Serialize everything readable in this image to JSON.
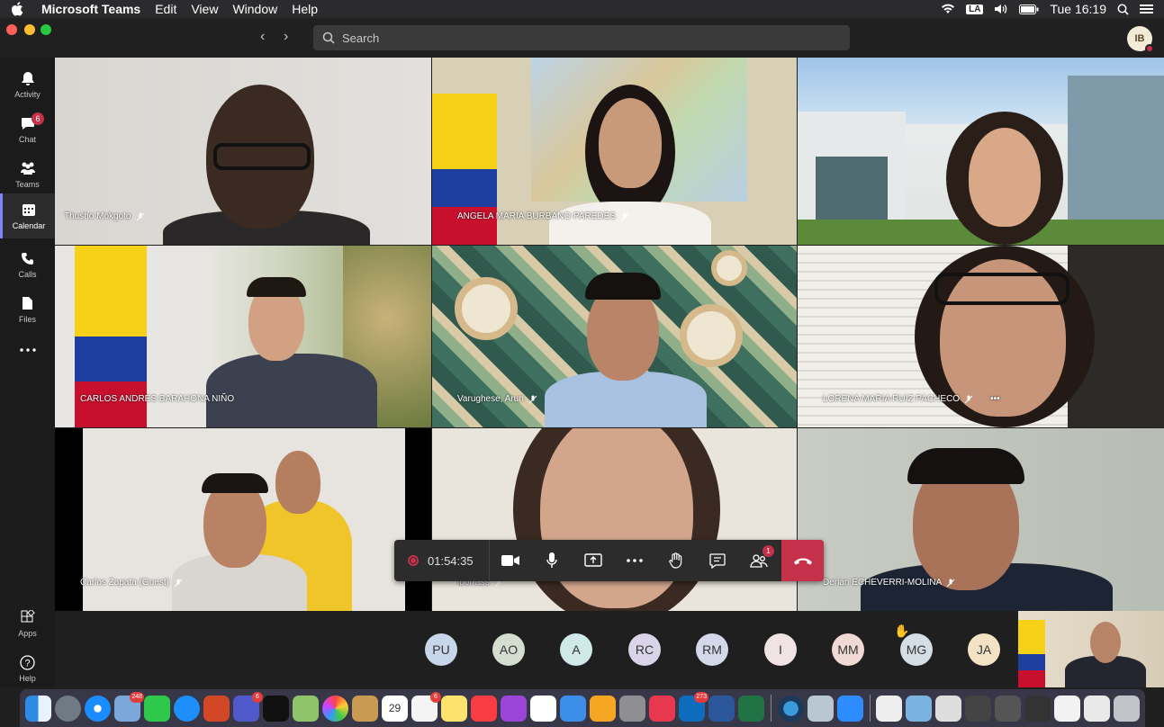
{
  "menubar": {
    "app_name": "Microsoft Teams",
    "items": [
      "Edit",
      "View",
      "Window",
      "Help"
    ],
    "input_source": "LA",
    "clock": "Tue 16:19"
  },
  "titlebar": {
    "search_placeholder": "Search",
    "profile_initials": "IB"
  },
  "rail": [
    {
      "label": "Activity",
      "icon": "bell-icon"
    },
    {
      "label": "Chat",
      "icon": "chat-icon",
      "badge": "6"
    },
    {
      "label": "Teams",
      "icon": "teams-icon"
    },
    {
      "label": "Calendar",
      "icon": "calendar-icon",
      "active": true
    },
    {
      "label": "Calls",
      "icon": "phone-icon"
    },
    {
      "label": "Files",
      "icon": "file-icon"
    },
    {
      "label": "Apps",
      "icon": "apps-icon"
    },
    {
      "label": "Help",
      "icon": "help-icon"
    }
  ],
  "participants_video": [
    {
      "name": "Thusho Mokgoto"
    },
    {
      "name": "ANGELA MARIA BURBANO PAREDES"
    },
    {
      "name": ""
    },
    {
      "name": "CARLOS ANDRES BARAHONA NIÑO"
    },
    {
      "name": "Varughese, Arun"
    },
    {
      "name": "LORENA MARIA RUIZ PACHECO"
    },
    {
      "name": "Carlos Zapata (Guest)"
    },
    {
      "name": "lborrass"
    },
    {
      "name": "Derian ECHEVERRI-MOLINA"
    }
  ],
  "controls": {
    "timer": "01:54:35",
    "participants_badge": "1"
  },
  "avatars": [
    {
      "initials": "PU",
      "color": "#c7d6ea"
    },
    {
      "initials": "AO",
      "color": "#d5dcd0"
    },
    {
      "initials": "A",
      "color": "#cfe8e8"
    },
    {
      "initials": "RC",
      "color": "#d9d4e8"
    },
    {
      "initials": "RM",
      "color": "#d4d8ea"
    },
    {
      "initials": "I",
      "color": "#efe3e3"
    },
    {
      "initials": "MM",
      "color": "#f1d9d5"
    },
    {
      "initials": "MG",
      "color": "#d5dde5",
      "hand_raised": true
    },
    {
      "initials": "JA",
      "color": "#f3e2c3"
    }
  ],
  "dock": {
    "badges": {
      "mail": "248",
      "teams": "6",
      "reminders": "6",
      "outlook": "273"
    },
    "calendar_day": "29"
  }
}
